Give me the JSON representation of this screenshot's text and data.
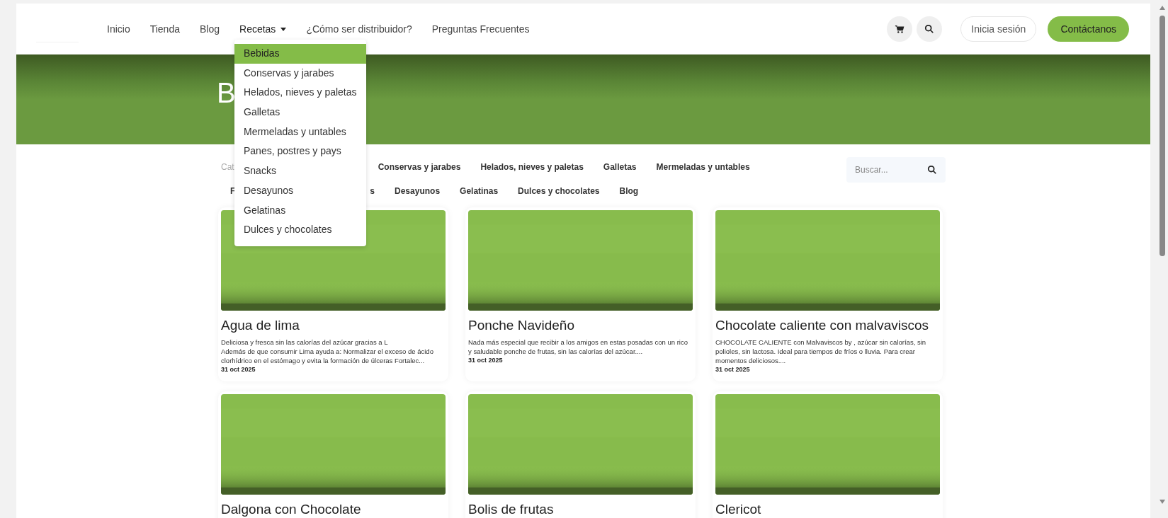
{
  "nav": {
    "items": [
      {
        "label": "Inicio",
        "kind": "link"
      },
      {
        "label": "Tienda",
        "kind": "link"
      },
      {
        "label": "Blog",
        "kind": "link"
      },
      {
        "label": "Recetas",
        "kind": "dropdown",
        "expanded": true
      },
      {
        "label": "¿Cómo ser distribuidor?",
        "kind": "link"
      },
      {
        "label": "Preguntas Frecuentes",
        "kind": "link"
      }
    ],
    "login": "Inicia sesión",
    "contact": "Contáctanos"
  },
  "dropdown": [
    {
      "label": "Bebidas",
      "selected": true
    },
    {
      "label": "Conservas y jarabes",
      "selected": false
    },
    {
      "label": "Helados, nieves y paletas",
      "selected": false
    },
    {
      "label": "Galletas",
      "selected": false
    },
    {
      "label": "Mermeladas y untables",
      "selected": false
    },
    {
      "label": "Panes, postres y pays",
      "selected": false
    },
    {
      "label": "Snacks",
      "selected": false
    },
    {
      "label": "Desayunos",
      "selected": false
    },
    {
      "label": "Gelatinas",
      "selected": false
    },
    {
      "label": "Dulces y chocolates",
      "selected": false
    }
  ],
  "hero": {
    "title": "B"
  },
  "filters": {
    "label": "Cat",
    "links": [
      {
        "label": "Conservas y jarabes",
        "kind": "link"
      },
      {
        "label": "Helados, nieves y paletas",
        "kind": "link"
      },
      {
        "label": "Galletas",
        "kind": "link"
      },
      {
        "label": "Mermeladas y untables",
        "kind": "link"
      },
      {
        "label": "F",
        "kind": "partial"
      },
      {
        "label": "s",
        "kind": "partial"
      },
      {
        "label": "Desayunos",
        "kind": "link"
      },
      {
        "label": "Gelatinas",
        "kind": "link"
      },
      {
        "label": "Dulces y chocolates",
        "kind": "link"
      },
      {
        "label": "Blog",
        "kind": "link"
      }
    ],
    "search": {
      "placeholder": "Buscar..."
    }
  },
  "posts": [
    {
      "title": "Agua de lima",
      "excerpt": "Deliciosa y fresca sin las calorías del azúcar gracias a L\nAdemás de que consumir Lima ayuda a: Normalizar el exceso de ácido clorhídrico en el estómago y evita la formación de úlceras Fortalec...",
      "date": "31 oct 2025"
    },
    {
      "title": "Ponche Navideño",
      "excerpt": "Nada más especial que recibir a los amigos en estas posadas con un rico y saludable ponche de frutas, sin las calorías del azúcar....",
      "date": "31 oct 2025"
    },
    {
      "title": "Chocolate caliente con malvaviscos",
      "excerpt": "CHOCOLATE CALIENTE con Malvaviscos by , azúcar sin calorías, sin polioles, sin lactosa. Ideal para tiempos de fríos o lluvia. Para crear momentos deliciosos....",
      "date": "31 oct 2025"
    },
    {
      "title": "Dalgona con Chocolate"
    },
    {
      "title": "Bolis de frutas"
    },
    {
      "title": "Clericot"
    }
  ]
}
